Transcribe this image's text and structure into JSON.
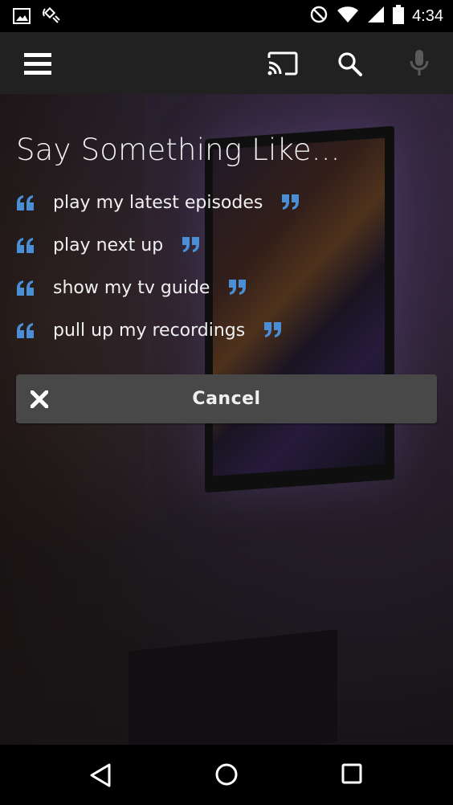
{
  "status_bar": {
    "time": "4:34",
    "left_icons": [
      "image-icon",
      "satellite-icon"
    ],
    "right_icons": [
      "do-not-disturb-icon",
      "wifi-icon",
      "signal-icon",
      "battery-icon"
    ]
  },
  "app_bar": {
    "icons": [
      "menu-icon",
      "cast-icon",
      "search-icon",
      "mic-icon"
    ]
  },
  "voice_prompt": {
    "heading": "Say Something Like...",
    "suggestions": [
      {
        "text": "play my latest episodes"
      },
      {
        "text": "play next up"
      },
      {
        "text": "show my tv guide"
      },
      {
        "text": "pull up my recordings"
      }
    ],
    "cancel_label": "Cancel"
  },
  "nav_bar": {
    "icons": [
      "back-icon",
      "home-icon",
      "recents-icon"
    ]
  },
  "colors": {
    "accent_quote": "#4a8fd6",
    "app_bar": "#212121",
    "cancel_button": "#484848"
  }
}
